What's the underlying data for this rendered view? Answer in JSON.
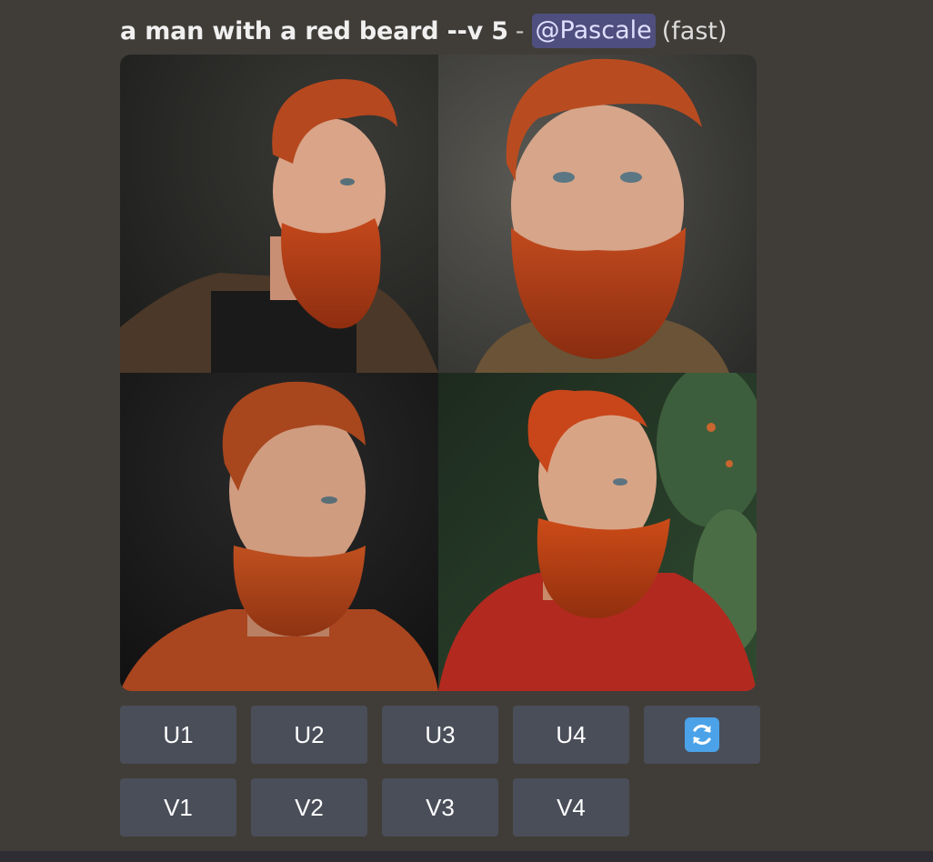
{
  "message": {
    "prompt": "a man with a red beard --v 5",
    "separator": "-",
    "mention": "@Pascale",
    "mode": "(fast)"
  },
  "image_grid": {
    "images": [
      {
        "index": 1
      },
      {
        "index": 2
      },
      {
        "index": 3
      },
      {
        "index": 4
      }
    ]
  },
  "buttons": {
    "upscale": [
      "U1",
      "U2",
      "U3",
      "U4"
    ],
    "variation": [
      "V1",
      "V2",
      "V3",
      "V4"
    ],
    "reroll_icon": "arrows-counterclockwise-icon"
  },
  "colors": {
    "background": "#403d38",
    "button": "#4a4e59",
    "mention_bg": "#4e4f7e",
    "reroll_icon_bg": "#4ba2e8",
    "beard": "#b8421c"
  }
}
